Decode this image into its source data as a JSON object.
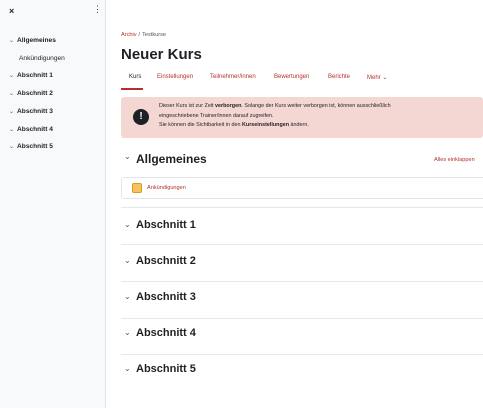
{
  "sidebar": {
    "close_icon": "×",
    "more_icon": "⋮",
    "items": [
      {
        "label": "Allgemeines",
        "chevron": "⌄"
      },
      {
        "label": "Ankündigungen"
      },
      {
        "label": "Abschnitt 1",
        "chevron": "⌄"
      },
      {
        "label": "Abschnitt 2",
        "chevron": "⌄"
      },
      {
        "label": "Abschnitt 3",
        "chevron": "⌄"
      },
      {
        "label": "Abschnitt 4",
        "chevron": "⌄"
      },
      {
        "label": "Abschnitt 5",
        "chevron": "⌄"
      }
    ]
  },
  "breadcrumb": {
    "root": "Archiv",
    "separator": "/",
    "current": "Testkurse"
  },
  "page_title": "Neuer Kurs",
  "tabs": [
    {
      "label": "Kurs",
      "active": true
    },
    {
      "label": "Einstellungen"
    },
    {
      "label": "Teilnehmer/innen"
    },
    {
      "label": "Bewertungen"
    },
    {
      "label": "Berichte"
    },
    {
      "label": "Mehr ⌄"
    }
  ],
  "alert": {
    "icon": "!",
    "line1_pre": "Dieser Kurs ist zur Zeit ",
    "line1_bold": "verborgen",
    "line1_post": ". Solange der Kurs weiter verborgen ist, können ausschließlich",
    "line2": "eingeschriebene Trainer/innen darauf zugreifen.",
    "line3_pre": "Sie können die Sichtbarkeit in den ",
    "line3_bold": "Kurseinstellungen",
    "line3_post": " ändern.",
    "background_color": "#f4d6d2"
  },
  "main": {
    "collapse_all": "Alles einklappen",
    "section_chevron": "⌄",
    "sections": [
      {
        "title": "Allgemeines"
      },
      {
        "title": "Abschnitt 1"
      },
      {
        "title": "Abschnitt 2"
      },
      {
        "title": "Abschnitt 3"
      },
      {
        "title": "Abschnitt 4"
      },
      {
        "title": "Abschnitt 5"
      }
    ],
    "activity": {
      "label": "Ankündigungen",
      "icon": "forum-icon"
    }
  },
  "colors": {
    "accent": "#b6302f",
    "text": "#1d2125",
    "sidebar_bg": "#f8f9fa"
  }
}
